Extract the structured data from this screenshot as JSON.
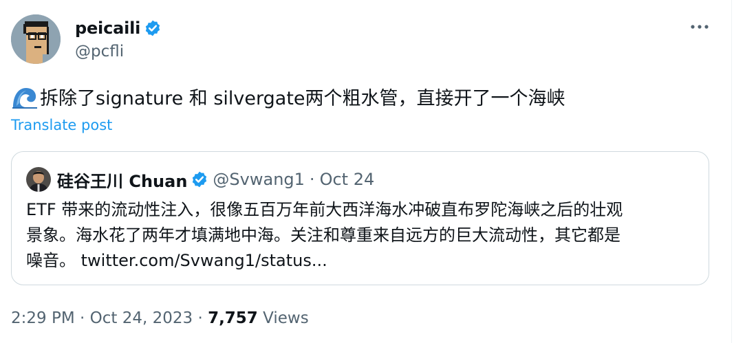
{
  "tweet": {
    "author_name": "peicaili",
    "author_handle": "@pcfli",
    "text": "拆除了signature 和 silvergate两个粗水管，直接开了一个海峡",
    "translate_label": "Translate post",
    "time": "2:29 PM",
    "date": "Oct 24, 2023",
    "separator": "·",
    "views_count": "7,757",
    "views_label": "Views"
  },
  "quote": {
    "author_name": "硅谷王川 Chuan",
    "handle": "@Svwang1",
    "separator": "·",
    "date": "Oct 24",
    "lines": [
      "ETF 带来的流动性注入，很像五百万年前大西洋海水冲破直布罗陀海峡之后的壮观",
      "景象。海水花了两年才填满地中海。关注和尊重来自远方的巨大流动性，其它都是",
      "噪音。 twitter.com/Svwang1/status..."
    ]
  },
  "icons": {
    "verified": "verified-badge-icon",
    "more": "more-options-icon",
    "wave": "water-wave-emoji",
    "avatar": "pixel-art-avatar"
  },
  "colors": {
    "brand_blue": "#1d9bf0",
    "text_primary": "#0f1419",
    "text_secondary": "#536471",
    "border": "#cfd9de"
  }
}
